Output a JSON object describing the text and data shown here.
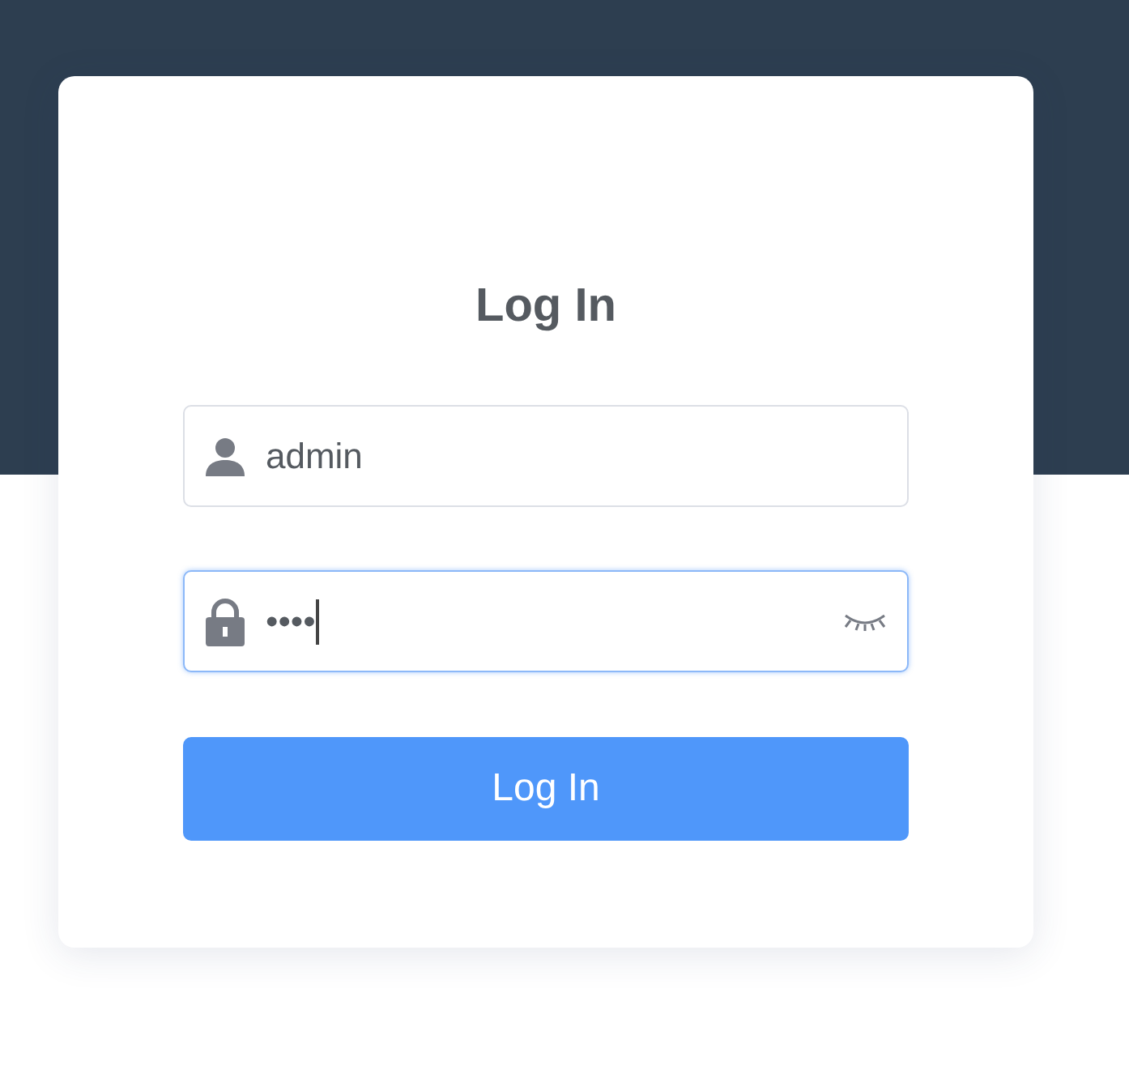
{
  "title": "Log In",
  "username": {
    "value": "admin"
  },
  "password": {
    "value": "••••",
    "focused": true
  },
  "button": {
    "label": "Log In"
  }
}
